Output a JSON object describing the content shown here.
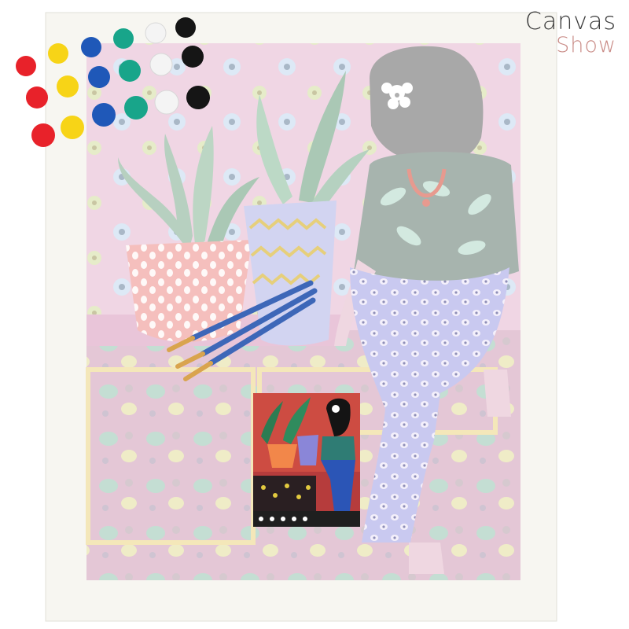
{
  "brand": {
    "line1": "Canvas",
    "line2": "Show"
  },
  "colors": {
    "brand_line1": "#3a3a3a",
    "brand_line2": "#c98b86",
    "canvas_frame": "#f7f6f1",
    "canvas_background": "#efd9e6",
    "floor": "#e7c9d8",
    "paint_pots": [
      "#e8222a",
      "#f7d417",
      "#1f58b8",
      "#18a58a",
      "#f4f4f4",
      "#151515"
    ]
  },
  "icons": [
    "paint-pot-icon",
    "paintbrush-icon"
  ]
}
